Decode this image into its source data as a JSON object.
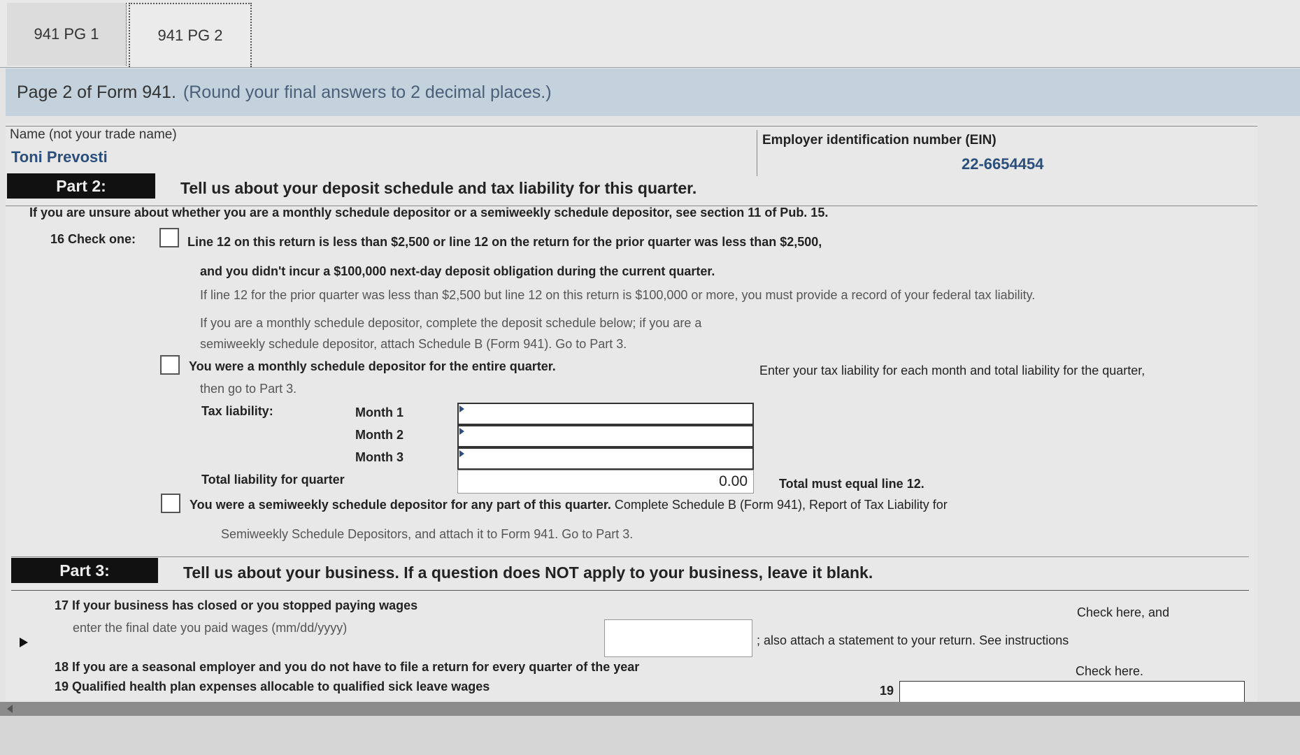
{
  "tabs": [
    {
      "label": "941 PG 1"
    },
    {
      "label": "941 PG 2"
    }
  ],
  "instruction": {
    "lead": "Page 2 of Form 941.",
    "note": "(Round your final answers to 2 decimal places.)"
  },
  "header": {
    "name_label": "Name (not your trade name)",
    "name_value": "Toni Prevosti",
    "ein_label": "Employer identification number (EIN)",
    "ein_value": "22-6654454"
  },
  "part2": {
    "badge": "Part 2:",
    "title": "Tell us about your deposit schedule and tax liability for this quarter.",
    "unsure_text": "If you are unsure about whether you are a monthly schedule depositor or a semiweekly schedule depositor, see section 11 of Pub. 15.",
    "check_one_label": "16 Check one:",
    "option1_line1": "Line 12 on this return is less than $2,500 or line 12 on the return for the prior quarter was less than $2,500,",
    "option1_line2": "and you didn't incur a $100,000 next-day deposit obligation during the current quarter.",
    "option1_line3": "If line 12 for the prior quarter was less than $2,500 but line 12 on this return is $100,000 or more, you must provide a record of your federal tax liability.",
    "option1_line4": "If you are a monthly schedule depositor, complete the deposit schedule below; if you are a",
    "option1_line5": "semiweekly schedule depositor, attach Schedule B (Form 941). Go to Part 3.",
    "option2_text": "You were a monthly schedule depositor for the entire quarter.",
    "option2_right": "Enter your tax liability for each month and total liability for the quarter,",
    "option2_then": "then go to Part 3.",
    "tax_liability_label": "Tax liability:",
    "month1": "Month 1",
    "month2": "Month 2",
    "month3": "Month 3",
    "total_label": "Total liability for quarter",
    "total_value": "0.00",
    "total_note": "Total must equal line 12.",
    "option3_bold": "You were a semiweekly schedule depositor for any part of this quarter.",
    "option3_rest": "Complete Schedule B (Form 941), Report of Tax Liability for",
    "option3_line2": "Semiweekly Schedule Depositors, and attach it to Form 941. Go to Part 3."
  },
  "part3": {
    "badge": "Part 3:",
    "title": "Tell us about your business.  If a question does NOT apply to your business, leave it blank.",
    "q17_line1": "17 If your business has closed or you stopped paying wages",
    "q17_line2": "enter the final date you paid wages (mm/dd/yyyy)",
    "q17_check": "Check here, and",
    "q17_attach": "; also attach a statement to your return. See instructions",
    "q18": "18 If you are a seasonal employer and you do not have to file a return for every quarter of the year",
    "q18_check": "Check here.",
    "q19": "19 Qualified health plan expenses allocable to qualified sick leave wages",
    "q19_num": "19"
  }
}
